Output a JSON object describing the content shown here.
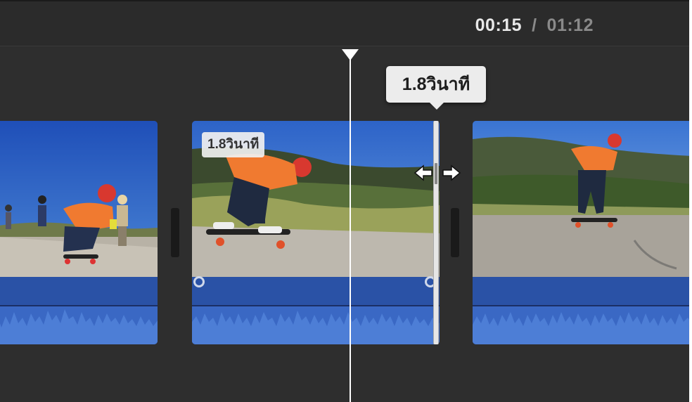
{
  "timecode": {
    "current": "00:15",
    "separator": "/",
    "total": "01:12"
  },
  "trim": {
    "tooltip_label": "1.8วินาที",
    "clip_duration_label": "1.8วินาที"
  },
  "clips": [
    {
      "name": "skateboard-clip-group"
    },
    {
      "name": "skateboard-clip-selected"
    },
    {
      "name": "skateboard-clip-road"
    }
  ],
  "colors": {
    "background": "#2e2e2e",
    "audio_track": "#2a52a6",
    "waveform": "#3a68c4",
    "playhead": "#ffffff",
    "tooltip_bg": "#ececec"
  },
  "icons": {
    "trim_cursor": "resize-horizontal-icon",
    "playhead": "playhead-triangle-icon",
    "fade_handle": "fade-handle-icon"
  }
}
